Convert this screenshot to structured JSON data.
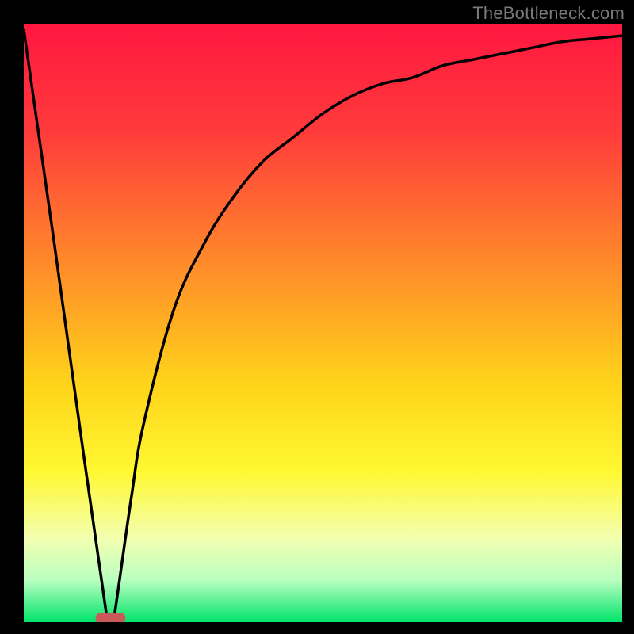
{
  "watermark": "TheBottleneck.com",
  "chart_data": {
    "type": "line",
    "title": "",
    "xlabel": "",
    "ylabel": "",
    "xlim": [
      0,
      100
    ],
    "ylim": [
      0,
      100
    ],
    "grid": false,
    "series": [
      {
        "name": "bottleneck-curve",
        "x": [
          0,
          5,
          10,
          14,
          15,
          16,
          18,
          20,
          25,
          30,
          35,
          40,
          45,
          50,
          55,
          60,
          65,
          70,
          75,
          80,
          85,
          90,
          95,
          100
        ],
        "values": [
          99,
          64,
          28,
          0,
          0,
          7,
          21,
          33,
          52,
          63,
          71,
          77,
          81,
          85,
          88,
          90,
          91,
          93,
          94,
          95,
          96,
          97,
          97.5,
          98
        ]
      }
    ],
    "marker": {
      "name": "optimal-range",
      "x": [
        12,
        17
      ],
      "y": 0,
      "color": "#c95a5a"
    },
    "gradient_stops": [
      {
        "pos": 0.0,
        "color": "#ff1740"
      },
      {
        "pos": 0.18,
        "color": "#ff3b3b"
      },
      {
        "pos": 0.4,
        "color": "#ff8a2a"
      },
      {
        "pos": 0.6,
        "color": "#ffd31a"
      },
      {
        "pos": 0.75,
        "color": "#fff833"
      },
      {
        "pos": 0.86,
        "color": "#f3ffb0"
      },
      {
        "pos": 0.93,
        "color": "#b9ffc0"
      },
      {
        "pos": 1.0,
        "color": "#00e46a"
      }
    ]
  }
}
